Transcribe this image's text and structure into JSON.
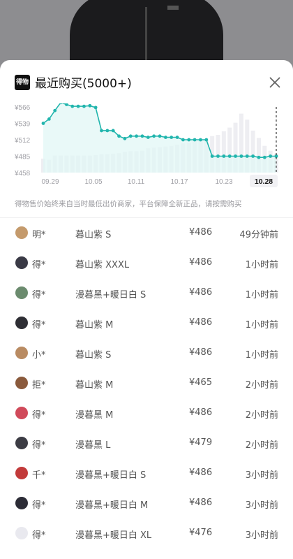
{
  "header": {
    "logo_text": "得物",
    "title": "最近购买(5000+)"
  },
  "chart_data": {
    "type": "bar",
    "y_ticks": [
      "¥566",
      "¥539",
      "¥512",
      "¥485",
      "¥458"
    ],
    "y_tick_values": [
      566,
      539,
      512,
      485,
      458
    ],
    "ylim": [
      458,
      566
    ],
    "x_labels": [
      "09.29",
      "10.05",
      "10.11",
      "10.17",
      "10.23"
    ],
    "selected_label": "10.28",
    "line_values": [
      539,
      546,
      560,
      573,
      570,
      567,
      567,
      567,
      568,
      565,
      527,
      527,
      527,
      518,
      514,
      518,
      518,
      518,
      516,
      518,
      518,
      516,
      516,
      516,
      512,
      512,
      512,
      512,
      512,
      485,
      485,
      485,
      485,
      485,
      485,
      485,
      485,
      483,
      483,
      485,
      485
    ],
    "bar_values": [
      481,
      479,
      486,
      486,
      486,
      486,
      486,
      486,
      486,
      487,
      488,
      488,
      489,
      490,
      492,
      493,
      493,
      494,
      498,
      499,
      500,
      501,
      502,
      504,
      506,
      507,
      510,
      510,
      512,
      518,
      520,
      526,
      532,
      540,
      555,
      545,
      527,
      515,
      502,
      494,
      489
    ],
    "colors": {
      "line": "#21b5ad",
      "bar": "#eeeef2",
      "fill": "#dff6f5"
    }
  },
  "note": "得物售价始终来自当时最低出价商家，平台保障全新正品，请按需购买",
  "rows": [
    {
      "name": "明*",
      "sku": "暮山紫 S",
      "price": "¥486",
      "time": "49分钟前",
      "avatar": "#c49a6c"
    },
    {
      "name": "得*",
      "sku": "暮山紫 XXXL",
      "price": "¥486",
      "time": "1小时前",
      "avatar": "#3a3a46"
    },
    {
      "name": "得*",
      "sku": "漫暮黑+暖日白 S",
      "price": "¥486",
      "time": "1小时前",
      "avatar": "#6b8b6e"
    },
    {
      "name": "得*",
      "sku": "暮山紫 M",
      "price": "¥486",
      "time": "1小时前",
      "avatar": "#2e2e34"
    },
    {
      "name": "小*",
      "sku": "暮山紫 S",
      "price": "¥486",
      "time": "1小时前",
      "avatar": "#b98b62"
    },
    {
      "name": "拒*",
      "sku": "暮山紫 M",
      "price": "¥465",
      "time": "2小时前",
      "avatar": "#8a5a3c"
    },
    {
      "name": "得*",
      "sku": "漫暮黑 M",
      "price": "¥486",
      "time": "2小时前",
      "avatar": "#d04a5a"
    },
    {
      "name": "得*",
      "sku": "漫暮黑 L",
      "price": "¥479",
      "time": "2小时前",
      "avatar": "#3c3c44"
    },
    {
      "name": "千*",
      "sku": "漫暮黑+暖日白 S",
      "price": "¥486",
      "time": "3小时前",
      "avatar": "#c23a3a"
    },
    {
      "name": "得*",
      "sku": "漫暮黑+暖日白 M",
      "price": "¥486",
      "time": "3小时前",
      "avatar": "#2c2c36"
    },
    {
      "name": "得*",
      "sku": "漫暮黑+暖日白 XL",
      "price": "¥476",
      "time": "3小时前",
      "avatar": "#e9e9ef"
    }
  ]
}
